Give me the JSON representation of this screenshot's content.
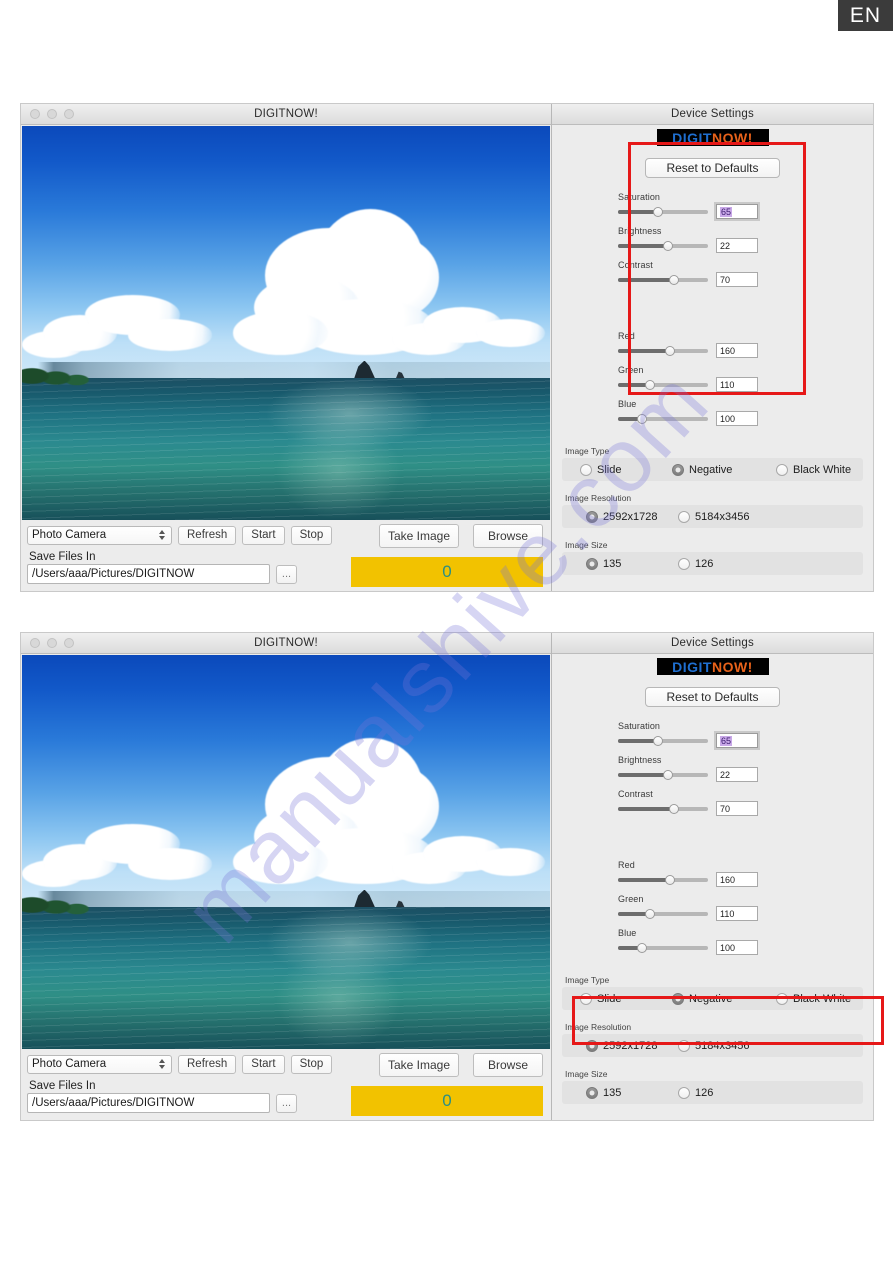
{
  "badge": {
    "label": "EN"
  },
  "watermark": {
    "text": "manualshive.com"
  },
  "window": {
    "title": "DIGITNOW!",
    "settings_title": "Device Settings",
    "logo": {
      "part1": "DIGIT",
      "part2": "NOW!"
    },
    "reset_label": "Reset to Defaults",
    "sliders": [
      {
        "label": "Saturation",
        "value": "65",
        "percent": 44,
        "focused": true
      },
      {
        "label": "Brightness",
        "value": "22",
        "percent": 56,
        "focused": false
      },
      {
        "label": "Contrast",
        "value": "70",
        "percent": 62,
        "focused": false
      },
      {
        "label": "Red",
        "value": "160",
        "percent": 58,
        "focused": false
      },
      {
        "label": "Green",
        "value": "110",
        "percent": 36,
        "focused": false
      },
      {
        "label": "Blue",
        "value": "100",
        "percent": 27,
        "focused": false
      }
    ],
    "image_type": {
      "title": "Image Type",
      "options": [
        {
          "label": "Slide",
          "selected": false
        },
        {
          "label": "Negative",
          "selected": true
        },
        {
          "label": "Black White",
          "selected": false
        }
      ]
    },
    "image_resolution": {
      "title": "Image Resolution",
      "options": [
        {
          "label": "2592x1728",
          "selected": true
        },
        {
          "label": "5184x3456",
          "selected": false
        }
      ]
    },
    "image_size": {
      "title": "Image Size",
      "options": [
        {
          "label": "135",
          "selected": true
        },
        {
          "label": "126",
          "selected": false
        }
      ]
    },
    "toolbar": {
      "device_select": "Photo Camera",
      "refresh_label": "Refresh",
      "start_label": "Start",
      "stop_label": "Stop",
      "take_image_label": "Take Image",
      "browse_label": "Browse",
      "save_files_label": "Save Files In",
      "path_value": "/Users/aaa/Pictures/DIGITNOW",
      "browse_dots": "...",
      "counter_value": "0"
    }
  },
  "colors": {
    "highlight_red": "#e61818",
    "counter_yellow": "#f2c200",
    "counter_text": "#2b8f84",
    "logo_blue": "#1f6fd0",
    "logo_orange": "#e8621a"
  }
}
